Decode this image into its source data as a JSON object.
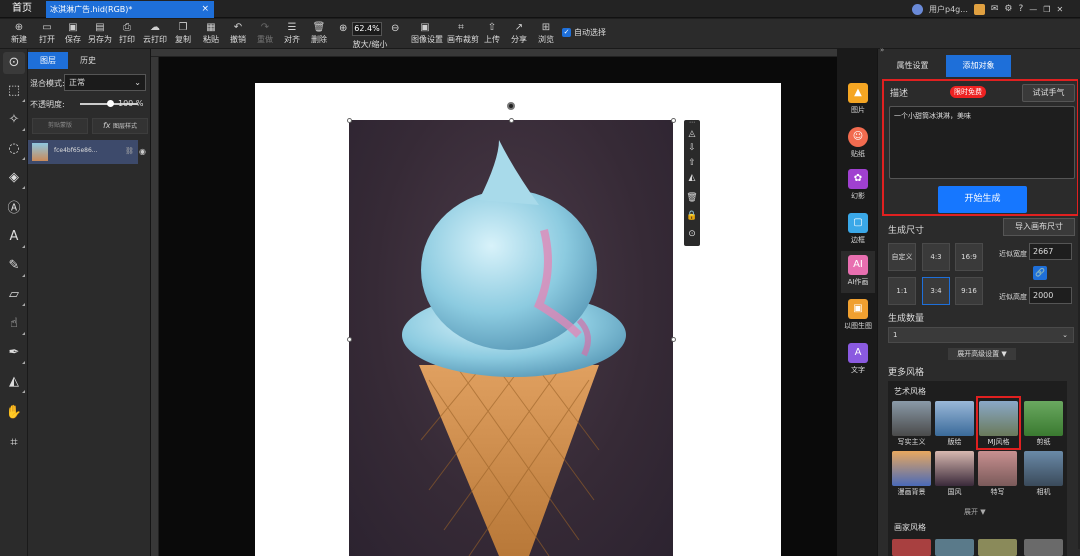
{
  "titlebar": {
    "home": "首页",
    "doc_tab": "冰淇淋广告.hid(RGB)*",
    "close": "×",
    "user": "用户p4g...",
    "window_controls": [
      "—",
      "❐",
      "✕"
    ]
  },
  "toolbar": {
    "new": "新建",
    "open": "打开",
    "save": "保存",
    "save_as": "另存为",
    "print": "打印",
    "cloud_print": "云打印",
    "copy": "复制",
    "paste": "粘贴",
    "undo": "撤销",
    "redo": "重做",
    "align": "对齐",
    "delete": "删除",
    "zoom_value": "62.4%",
    "zoom_label": "放大/缩小",
    "image_settings": "图像设置",
    "canvas_crop": "画布裁剪",
    "upload": "上传",
    "share": "分享",
    "browse": "浏览",
    "auto_select": "自动选择"
  },
  "layers_panel": {
    "tab_layers": "图层",
    "tab_history": "历史",
    "blend_label": "混合模式:",
    "blend_value": "正常",
    "opacity_label": "不透明度:",
    "opacity_value": "100 %",
    "clip_btn": "剪贴蒙版",
    "style_btn": "图层样式",
    "layer_name": "fce4bf65e86..."
  },
  "right_icons": [
    {
      "label": "图片",
      "color": "#f5a623"
    },
    {
      "label": "贴纸",
      "color": "#f26b4f"
    },
    {
      "label": "幻影",
      "color": "#a040d0"
    },
    {
      "label": "边框",
      "color": "#3aa8e8"
    },
    {
      "label": "AI作画",
      "color": "#e86fb0"
    },
    {
      "label": "以图生图",
      "color": "#f0a030"
    },
    {
      "label": "文字",
      "color": "#8a5ae0"
    }
  ],
  "right_panel": {
    "tab_props": "属性设置",
    "tab_add": "添加对象",
    "desc_title": "描述",
    "free_badge": "限时免费",
    "try_btn": "试试手气",
    "desc_text": "一个小甜筒冰淇淋，美味",
    "gen_btn": "开始生成",
    "size_title": "生成尺寸",
    "import_btn": "导入画布尺寸",
    "ratios": [
      "自定义",
      "4:3",
      "16:9",
      "1:1",
      "3:4",
      "9:16"
    ],
    "width_label": "近似宽度",
    "width_value": "2667",
    "height_label": "近似高度",
    "height_value": "2000",
    "count_title": "生成数量",
    "count_value": "1",
    "adv_btn": "展开高级设置 ▼",
    "more_title": "更多风格",
    "cat_art": "艺术风格",
    "styles": [
      "写实主义",
      "版绘",
      "MJ风格",
      "剪纸",
      "漫画背景",
      "国风",
      "特写",
      "相机"
    ],
    "expand": "展开 ▼",
    "cat_artist": "画家风格"
  },
  "colors": {
    "accent": "#1e6fd9",
    "highlight_red": "#e02020"
  }
}
